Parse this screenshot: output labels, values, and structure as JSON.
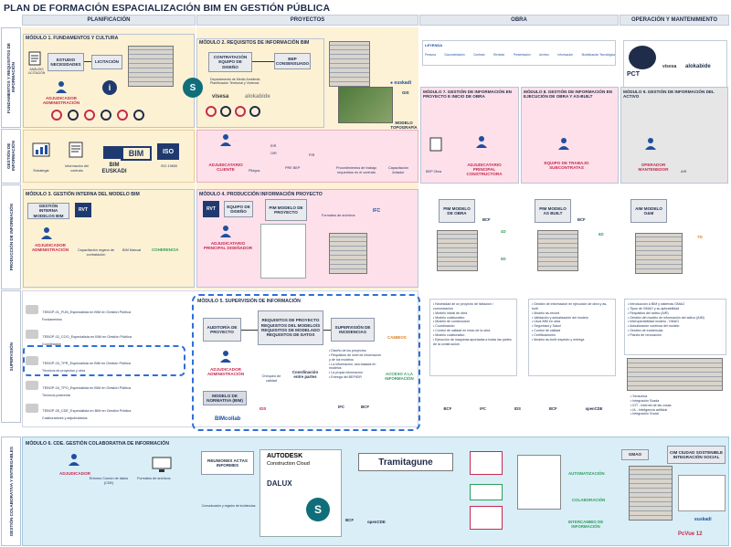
{
  "title": "PLAN DE FORMACIÓN ESPACIALIZACIÓN BIM EN GESTIÓN PÚBLICA",
  "columns": [
    "PLANIFICACIÓN",
    "PROYECTOS",
    "OBRA",
    "OPERACIÓN Y MANTENIMIENTO"
  ],
  "rows": [
    "FUNDAMENTOS Y REQUISITOS DE INFORMACIÓN",
    "GESTIÓN DE INFORMACIÓN",
    "PRODUCCIÓN DE INFORMACIÓN",
    "SUPERVISIÓN",
    "GESTIÓN COLABORATIVA Y ENTREGABLES"
  ],
  "m1": {
    "title": "MÓDULO 1. FUNDAMENTOS Y CULTURA",
    "estudio": "ESTUDIO NECESIDADES",
    "licitacion": "LICITACIÓN",
    "analisis": "ANÁLISIS LICITACIÓN",
    "adjudicador": "ADJUDICADOR ADMINISTRACIÓN"
  },
  "m2": {
    "title": "MÓDULO 2. REQUISITOS DE INFORMACIÓN BIM",
    "contratacion": "CONTRATACIÓN EQUIPO DE DISEÑO",
    "bep": "BEP CONSENSUADO",
    "departamento": "Departamento de Medio Ambiente, Planificación Territorial y Vivienda",
    "visesa": "visesa",
    "alokabide": "alokabide",
    "gis": "GIS",
    "modelo_topo": "MODELO TOPOGRAFÍA",
    "adjudicatario": "ADJUDICATARIO CLIENTE",
    "pliegos": "Pliegos",
    "eir": "EIR",
    "oir": "OIR",
    "pir": "PIR",
    "air": "AIR",
    "prebep": "PRE BEP"
  },
  "gest": {
    "estrategia": "Estrategia",
    "info_contrato": "Información del contrato",
    "bim_euskadi": "BIM EUSKADI",
    "bim": "BIM",
    "iso": "ISO 19650",
    "procedimientos": "Procedimientos de trabajo requeridos en el contrato",
    "capacitacion": "Capacitación licitador"
  },
  "m3": {
    "title": "MÓDULO 3. GESTIÓN INTERNA DEL MODELO BIM",
    "gestion_interna": "GESTIÓN INTERNA MODELOS BIM",
    "rvt": "RVT",
    "adjudicador": "ADJUDICADOR ADMINISTRACIÓN",
    "capacitacion": "Capacitación órgano de contratación",
    "manual": "BIM Manual",
    "coherencia": "COHERENCIA"
  },
  "m4": {
    "title": "MÓDULO 4. PRODUCCIÓN INFORMACIÓN PROYECTO",
    "equipo": "EQUIPO DE DISEÑO",
    "pim": "PIM MODELO DE PROYECTO",
    "formatos": "Formatos de archivos",
    "ifc": "IFC",
    "adjudicatario": "ADJUDICATARIO PRINCIPAL DISEÑADOR"
  },
  "m7": {
    "title": "MÓDULO 7. GESTIÓN DE INFORMACIÓN EN PROYECTO E INICIO DE OBRA",
    "bep_obra": "BEP Obra",
    "adjudicatario": "ADJUDICATARIO PRINCIPAL CONSTRUCTORA",
    "pim": "PIM MODELO DE OBRA",
    "bcf": "BCF",
    "d4": "4D",
    "d5": "5D"
  },
  "m8": {
    "title": "MÓDULO 8. GESTIÓN DE INFORMACIÓN EN EJECUCIÓN DE OBRA Y AS-BUILT",
    "equipo": "EQUIPO DE TRABAJO SUBCONTRATAS",
    "pim": "PIM MODELO AS BUILT",
    "bcf": "BCF",
    "d6": "6D"
  },
  "m9": {
    "title": "MÓDULO 9. GESTIÓN DE INFORMACIÓN DEL ACTIVO",
    "operador": "OPERADOR MANTENEDOR",
    "air": "AIR",
    "aim": "AIM MODELO O&M",
    "d7": "7D",
    "pct": "PCT",
    "visesa": "visesa",
    "alokabide": "alokabide"
  },
  "legend": {
    "title": "LEYENDA",
    "items": [
      "Persona",
      "Documentación",
      "Contrato",
      "Revisión",
      "Presentación",
      "Archivo",
      "Información",
      "Modelización Tecnológica"
    ]
  },
  "m5": {
    "title": "MÓDULO 5. SUPERVISIÓN DE INFORMACIÓN",
    "auditoria": "AUDITORÍA DE PROYECTO",
    "requisitos": "REQUISITOS DE PROYECTO REQUISITOS DEL MODELO/S REQUISITOS DE MODELADO REQUISITOS DE DATOS",
    "supervision": "SUPERVISIÓN DE INCIDENCIAS",
    "adjudicador": "ADJUDICADOR ADMINISTRACIÓN",
    "modelo_normativa": "MODELO DE NORMATIVA (BIM)",
    "chequeo": "Chequeo de calidad",
    "coordinacion": "Coordinación entre partes",
    "acceso": "ACCESO A LA INFORMACIÓN",
    "cambios": "CAMBIOS",
    "ids": "IDS",
    "bimcollab": "BIMcollab",
    "bullets": [
      "Diseño de los proyectos",
      "Requisitos de nivel de información y de los modelos",
      "La información, sea basada en modelos",
      "La propia información",
      "Entrega del BEP/EIR"
    ],
    "bcf": "BCF",
    "ifc": "IFC"
  },
  "tebgp": [
    {
      "code": "TEBGP-01_FUN_Especialista en BIM en Gestión Pública",
      "desc": "Fundamentos"
    },
    {
      "code": "TEBGP-02_COO_Especialista en BIM en Gestión Pública",
      "desc": "Coordinación"
    },
    {
      "code": "TEBGP-03_TPR_Especialista en BIM en Gestión Pública",
      "desc": "Técnicos de proyectos y obra"
    },
    {
      "code": "TEBGP-04_TPO_Especialista en BIM en Gestión Pública",
      "desc": "Técnicos postventa"
    },
    {
      "code": "TEBGP-05_CDE_Especialista en BIM en Gestión Pública",
      "desc": "Colaboradores y adjudicatarios"
    }
  ],
  "obra_bullets1": [
    "Necesidad de un proyecto de licitación / comunicación",
    "Modelo inicial de obra",
    "Modelo colaborativo",
    "Modelo de construcción",
    "Coordinación",
    "Control de calidad en inicio de la obra",
    "Modelo colaborativo",
    "Ejecución de maquinas aportadas a todas las partes de la construcción"
  ],
  "obra_bullets2": [
    "Gestión de información en ejecución de obra y as-built",
    "Modelo as-record",
    "Validación y actualización del modelo",
    "Usos BIM en obra",
    "Seguridad y Salud",
    "Control de calidad",
    "Certificaciones",
    "Modelo as-built respecto y entrega"
  ],
  "om_bullets": [
    "Introducción a BIM y sistemas GMAO",
    "Tipos de GMAO y su aplicabilidad",
    "Requisitos del activo (AIR)",
    "Gestión del modelo de información del activo (AIM)",
    "Interoperabilidad modelo - GMAO",
    "Actualización continua del modelo",
    "Gestión de incidencias",
    "Planes de renovación"
  ],
  "om_bullets2": [
    "Sensórica",
    "Integración Scada",
    "IOT - Internet de las cosas",
    "IA - Inteligencia artificial",
    "Integración Social"
  ],
  "formats_row": [
    "BCF",
    "IFC",
    "IDS",
    "BCF",
    "openCDE"
  ],
  "m6": {
    "title": "MÓDULO 6. CDE. GESTIÓN COLABORATIVA DE INFORMACIÓN",
    "adjudicador": "ADJUDICADOR",
    "entorno": "Entorno Común de datos (CDE)",
    "formatos": "Formatos de archivos",
    "reuniones": "REUNIONES ACTAS INFORMES",
    "comunicacion": "Comunicación y registro de incidencias",
    "autodesk": "AUTODESK",
    "construction_cloud": "Construction Cloud",
    "dalux": "DALUX",
    "tramitagune": "Tramitagune",
    "bcf": "BCF",
    "opencde": "openCDE",
    "automatizacion": "AUTOMATIZACIÓN",
    "colaboracion": "COLABORACIÓN",
    "intercambio": "INTERCAMBIO DE INFORMACIÓN",
    "gmao": "GMAO",
    "cim": "CIM CIUDAD SOSTENIBLE INTEGRACIÓN SOCIAL",
    "pcvue": "PcVue 12",
    "euskadi": "euskadi"
  },
  "colors": {
    "planif_bg": "#fdf1d4",
    "proj_bg": "#fde0ea",
    "om_bg": "#e6e6e6",
    "blue_band": "#d5ecf6",
    "accent": "#2e6fd8",
    "red": "#c62a4f",
    "navy": "#1f2d4a"
  }
}
